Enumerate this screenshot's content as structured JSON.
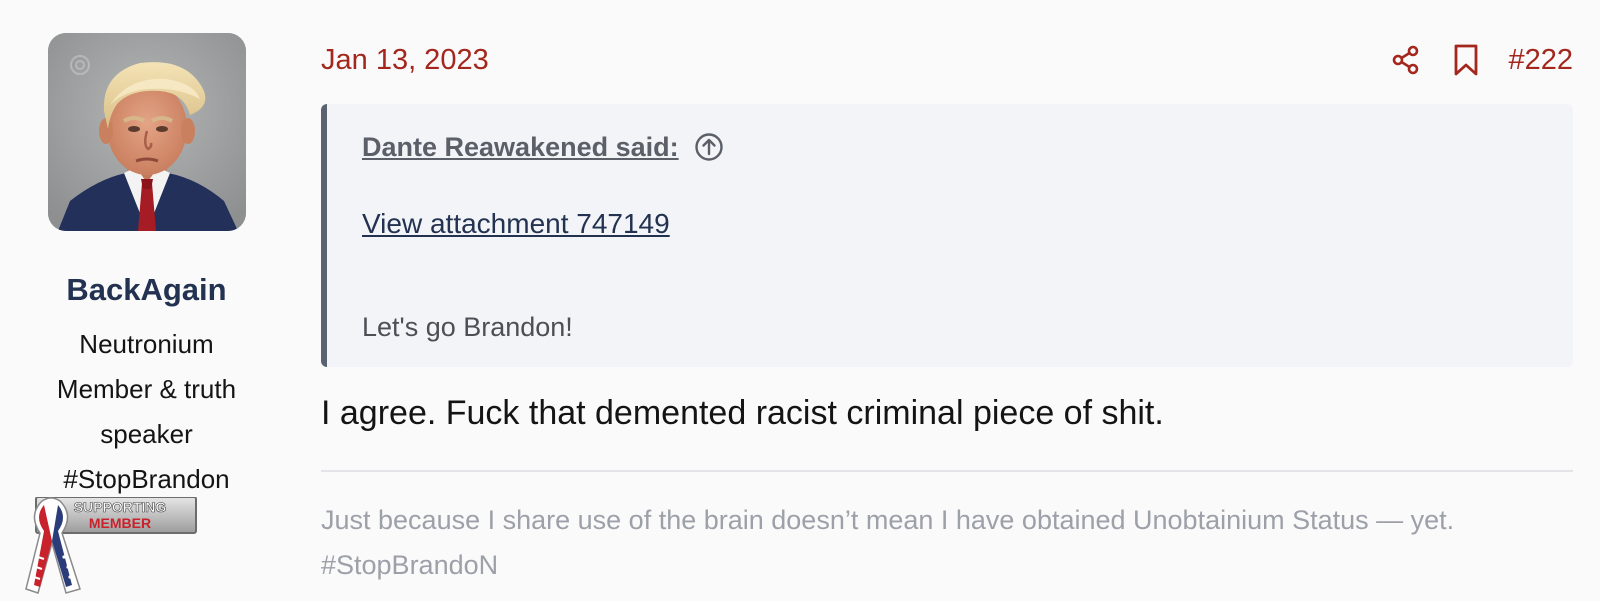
{
  "user": {
    "username": "BackAgain",
    "title": "Neutronium Member & truth speaker #StopBrandon",
    "badge_line1": "SUPPORTING",
    "badge_line2": "MEMBER"
  },
  "post": {
    "date": "Jan 13, 2023",
    "number": "#222",
    "share_icon": "share-icon",
    "bookmark_icon": "bookmark-icon",
    "quote": {
      "author_said": "Dante Reawakened said:",
      "jump_icon": "arrow-up-circle-icon",
      "attachment_link": "View attachment 747149",
      "text": "Let's go Brandon!"
    },
    "body": "I agree. Fuck that demented racist criminal piece of shit.",
    "signature": "Just because I share use of the brain doesn’t mean I have obtained Unobtainium Status — yet. #StopBrandoN"
  },
  "colors": {
    "accent_red": "#a4271d",
    "username_navy": "#233250",
    "quote_bg": "#f2f4f7",
    "quote_bar": "#5a6170",
    "signature_gray": "#9da0a8"
  }
}
